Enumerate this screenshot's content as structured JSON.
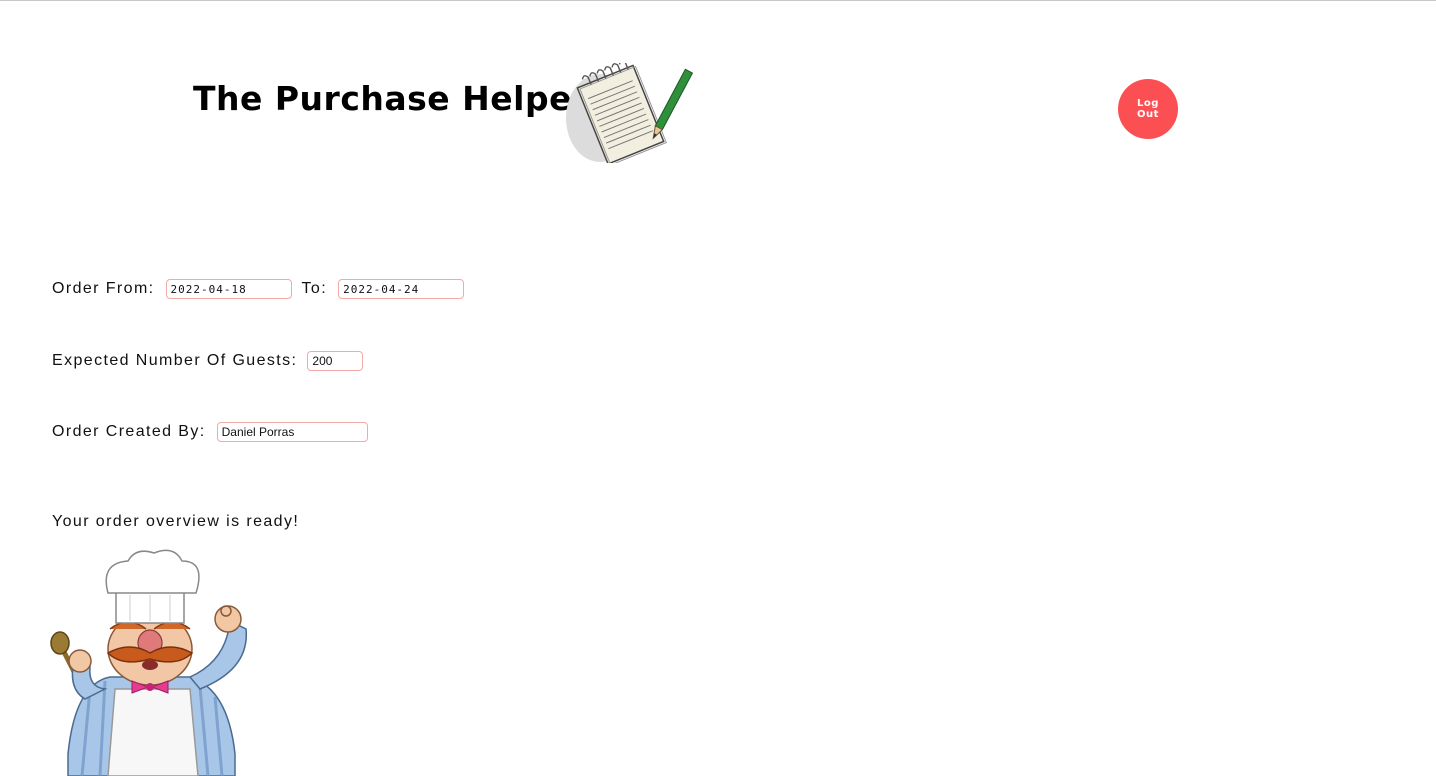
{
  "header": {
    "title": "The Purchase Helper",
    "logout_label": "Log Out",
    "logout_color": "#fb4f53"
  },
  "form": {
    "order_from_label": "Order From:",
    "order_from_value": "2022-04-18",
    "to_label": "To:",
    "to_value": "2022-04-24",
    "guests_label": "Expected Number Of Guests:",
    "guests_value": "200",
    "created_by_label": "Order Created By:",
    "created_by_value": "Daniel Porras",
    "field_border_color": "#f2aaa6"
  },
  "status": {
    "message": "Your order overview is ready!"
  },
  "images": {
    "header_icon": "notepad-pencil-icon",
    "mascot": "chef-mascot-illustration"
  }
}
